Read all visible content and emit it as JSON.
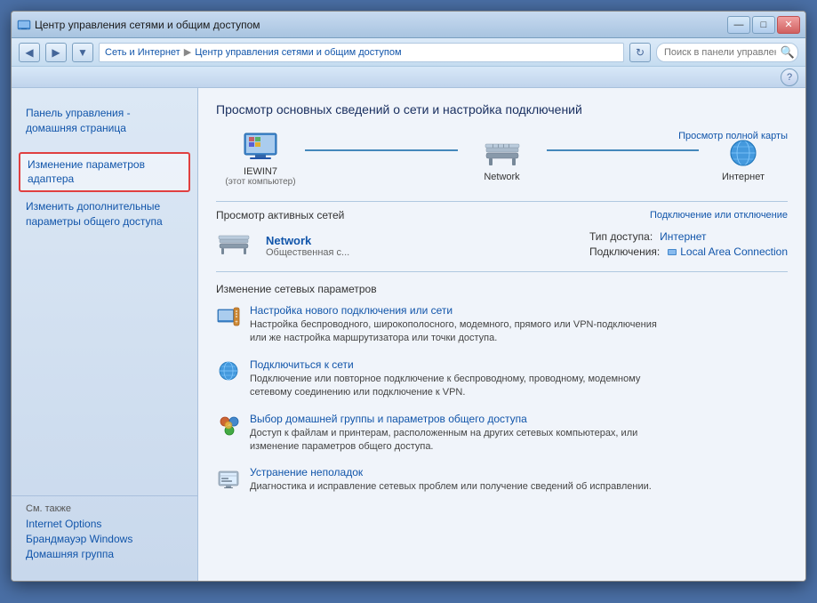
{
  "window": {
    "title": "Центр управления сетями и общим доступом",
    "titlebar_controls": [
      "—",
      "□",
      "✕"
    ]
  },
  "addressbar": {
    "back_btn": "◀",
    "forward_btn": "▶",
    "dropdown_btn": "▼",
    "breadcrumb": [
      {
        "label": "Сеть и Интернет"
      },
      {
        "label": "Центр управления сетями и общим доступом"
      }
    ],
    "refresh_btn": "↻",
    "search_placeholder": "Поиск в панели управления"
  },
  "toolbar": {
    "help_title": "?"
  },
  "sidebar": {
    "home_line1": "Панель управления -",
    "home_line2": "домашняя страница",
    "nav_items": [
      {
        "label": "Изменение параметров\nадаптера",
        "highlighted": true
      },
      {
        "label": "Изменить дополнительные\nпараметры общего доступа",
        "highlighted": false
      }
    ],
    "also_section": "См. также",
    "also_items": [
      {
        "label": "Internet Options"
      },
      {
        "label": "Брандмауэр Windows"
      },
      {
        "label": "Домашняя группа"
      }
    ]
  },
  "content": {
    "title": "Просмотр основных сведений о сети и настройка подключений",
    "view_map_link": "Просмотр полной карты",
    "nodes": [
      {
        "label": "IEWIN7",
        "sublabel": "(этот компьютер)",
        "type": "computer"
      },
      {
        "label": "Network",
        "sublabel": "",
        "type": "bench"
      },
      {
        "label": "Интернет",
        "sublabel": "",
        "type": "globe"
      }
    ],
    "active_networks_label": "Просмотр активных сетей",
    "connect_disconnect_link": "Подключение или отключение",
    "active_network": {
      "name": "Network",
      "type": "Общественная с...",
      "access_type_label": "Тип доступа:",
      "access_type_value": "Интернет",
      "connections_label": "Подключения:",
      "connections_value": "Local Area Connection"
    },
    "change_settings_label": "Изменение сетевых параметров",
    "settings_items": [
      {
        "link": "Настройка нового подключения или сети",
        "desc": "Настройка беспроводного, широкополосного, модемного, прямого или VPN-подключения\nили же настройка маршрутизатора или точки доступа."
      },
      {
        "link": "Подключиться к сети",
        "desc": "Подключение или повторное подключение к беспроводному, проводному, модемному\nсетевому соединению или подключение к VPN."
      },
      {
        "link": "Выбор домашней группы и параметров общего доступа",
        "desc": "Доступ к файлам и принтерам, расположенным на других сетевых компьютерах, или\nизменение параметров общего доступа."
      },
      {
        "link": "Устранение неполадок",
        "desc": "Диагностика и исправление сетевых проблем или получение сведений об исправлении."
      }
    ]
  },
  "arrow": {
    "visible": true
  }
}
